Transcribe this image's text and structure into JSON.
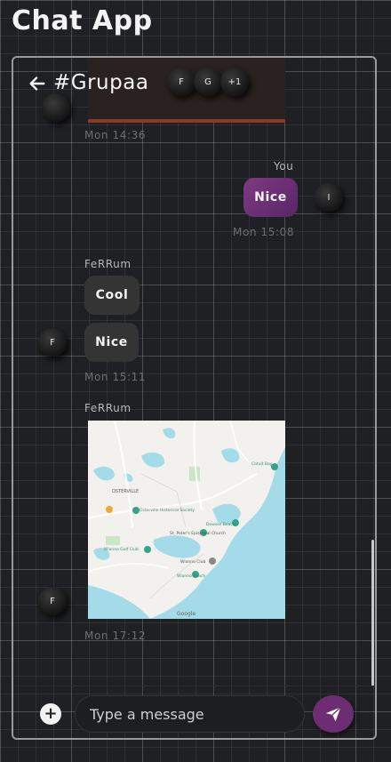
{
  "app": {
    "title": "Chat App"
  },
  "header": {
    "channel": "#Grupaa",
    "members": [
      "F",
      "G",
      "+1"
    ]
  },
  "messages": [
    {
      "kind": "image",
      "time": "Mon 14:36"
    },
    {
      "kind": "text",
      "sender": "You",
      "avatar": "I",
      "texts": [
        "Nice"
      ],
      "time": "Mon 15:08"
    },
    {
      "kind": "text",
      "sender": "FeRRum",
      "avatar": "F",
      "texts": [
        "Cool",
        "Nice"
      ],
      "time": "Mon 15:11"
    },
    {
      "kind": "map",
      "sender": "FeRRum",
      "avatar": "F",
      "time": "Mon 17:12",
      "map_labels": [
        "OSTERVILLE",
        "Osterville Historical Society",
        "Wianno Golf Club",
        "St. Peter's Episcopal Church",
        "Dowses Beach",
        "Wianno Club",
        "Wianno Beach",
        "Cotuit Bay",
        "Google"
      ]
    }
  ],
  "composer": {
    "placeholder": "Type a message",
    "plus_icon": "plus-icon",
    "send_icon": "send-icon"
  },
  "colors": {
    "accent": "#6c2d73",
    "background": "#1f2023",
    "bubble_other": "#343434"
  }
}
